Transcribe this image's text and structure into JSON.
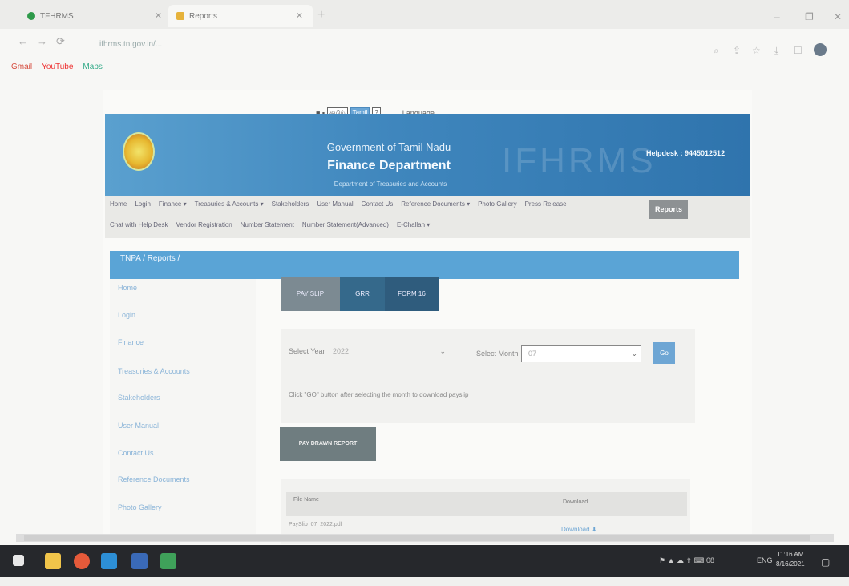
{
  "browser": {
    "tabs": [
      {
        "label": "TFHRMS"
      },
      {
        "label": "Reports"
      }
    ],
    "new_tab": "+",
    "window_controls": [
      "–",
      "❐",
      "✕"
    ],
    "nav": [
      "←",
      "→",
      "⟳"
    ],
    "url": "ifhrms.tn.gov.in/...",
    "bookmarks": [
      {
        "label": "Gmail"
      },
      {
        "label": "YouTube"
      },
      {
        "label": "Maps"
      }
    ]
  },
  "site": {
    "lang_options": [
      "தமிழ்",
      "Tamil",
      "?"
    ],
    "language_dropdown": "Language",
    "gov_title": "Government of Tamil Nadu",
    "dept_title": "Finance Department",
    "sub_dept": "Department of Treasuries and Accounts",
    "brand": "IFHRMS",
    "helpdesk": "Helpdesk : 9445012512",
    "menu_row1": [
      "Home",
      "Login",
      "Finance ▾",
      "Treasuries & Accounts ▾",
      "Stakeholders",
      "User Manual",
      "Contact Us",
      "Reference Documents ▾",
      "Photo Gallery",
      "Press Release"
    ],
    "menu_reports": "Reports",
    "menu_row2": [
      "Chat with Help Desk",
      "Vendor Registration",
      "Number Statement",
      "Number Statement(Advanced)",
      "E-Challan ▾"
    ]
  },
  "main": {
    "breadcrumb": "TNPA / Reports /",
    "sidebar": [
      "Home",
      "Login",
      "Finance",
      "Treasuries & Accounts",
      "Stakeholders",
      "User Manual",
      "Contact Us",
      "Reference Documents",
      "Photo Gallery"
    ],
    "report_tabs": [
      "PAY SLIP",
      "GRR",
      "FORM 16"
    ],
    "year_label": "Select Year",
    "year_value": "2022",
    "month_label": "Select Month",
    "month_value": "07",
    "go_label": "Go",
    "hint": "Click \"GO\" button after selecting the month to download payslip",
    "report_button": "PAY DRAWN REPORT",
    "table": {
      "headers": [
        "File Name",
        "Download"
      ],
      "rows": [
        {
          "file": "PaySlip_07_2022.pdf",
          "action": "Download"
        }
      ]
    }
  },
  "taskbar": {
    "clock_time": "11:16 AM",
    "clock_date": "8/16/2021",
    "lang": "ENG",
    "tray": "⚑ ▲ ☁ ⇧ ⌨ 08"
  }
}
